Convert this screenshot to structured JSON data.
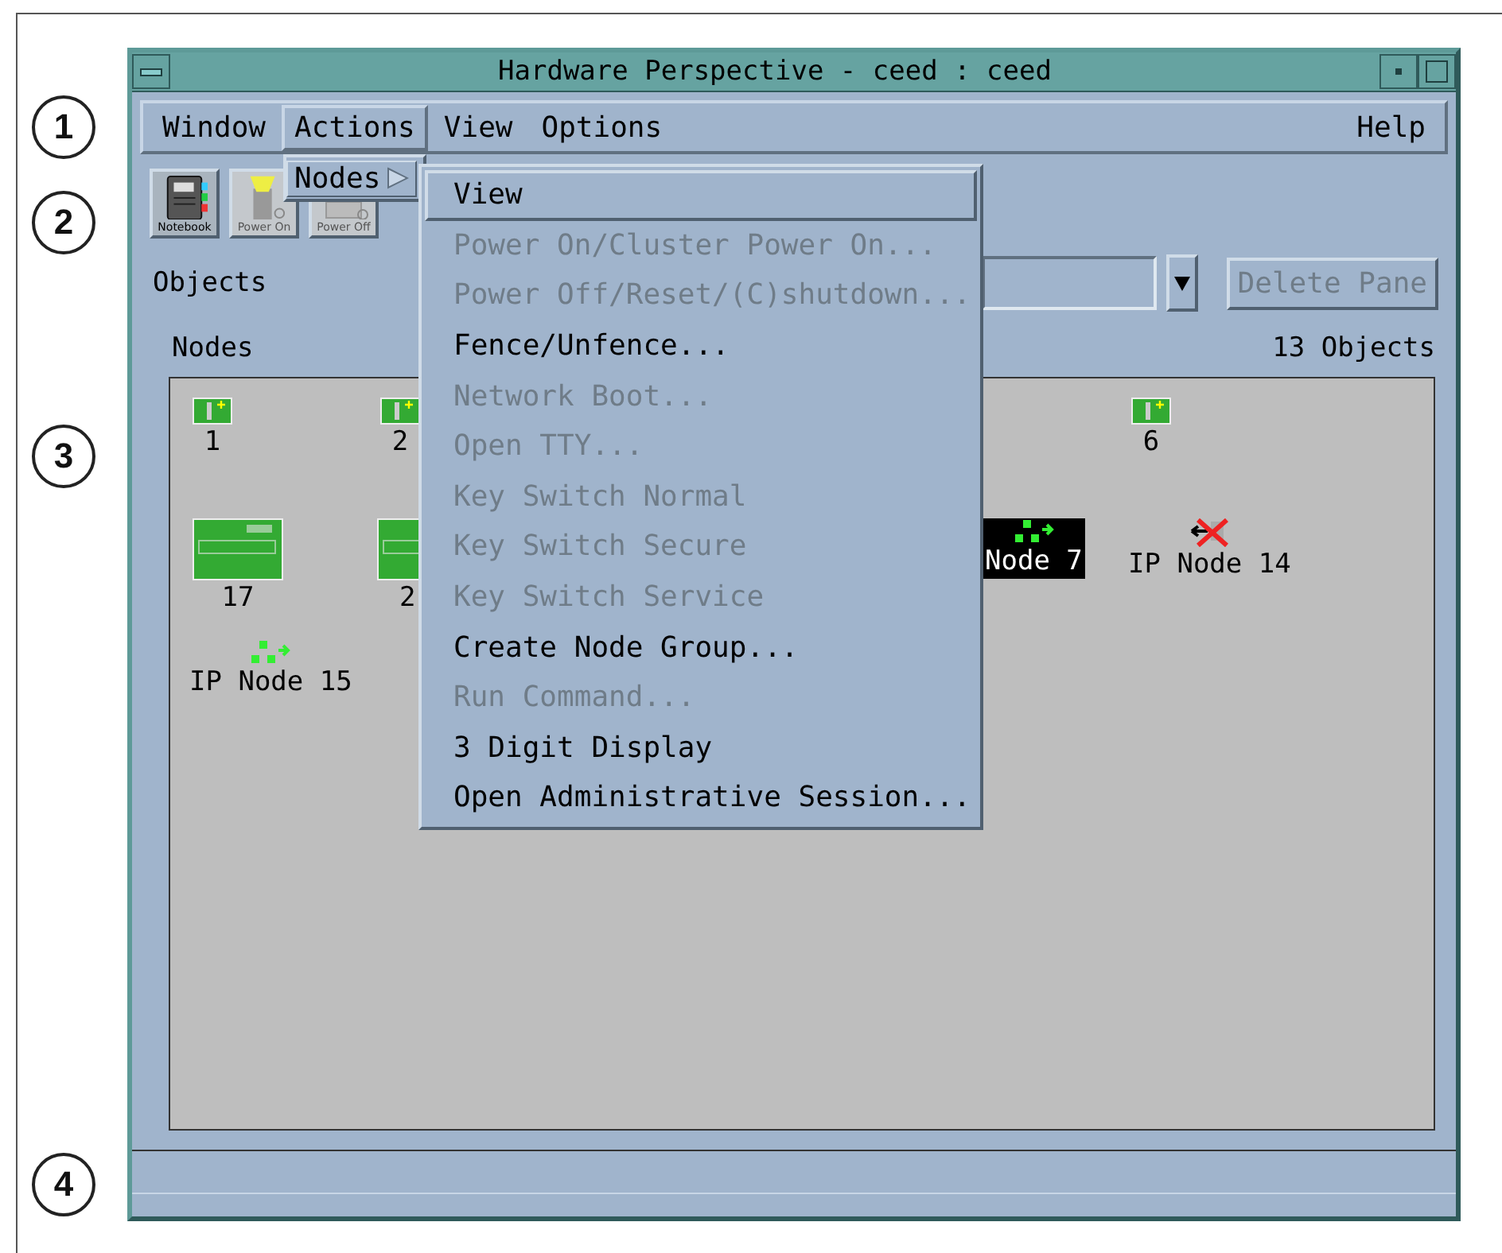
{
  "callouts": [
    "1",
    "2",
    "3",
    "4"
  ],
  "window": {
    "title": "Hardware Perspective - ceed : ceed"
  },
  "menubar": [
    {
      "label": "Window",
      "selected": false
    },
    {
      "label": "Actions",
      "selected": true
    },
    {
      "label": "View",
      "selected": false
    },
    {
      "label": "Options",
      "selected": false
    },
    {
      "label": "Help",
      "selected": false
    }
  ],
  "toolbar": [
    {
      "label": "Notebook",
      "kind": "notebook",
      "disabled": false
    },
    {
      "label": "Power On",
      "kind": "power-on",
      "disabled": true
    },
    {
      "label": "Power Off",
      "kind": "power-off",
      "disabled": true
    }
  ],
  "objects": {
    "label": "Objects",
    "delete_button": {
      "label": "Delete Pane",
      "disabled": true
    }
  },
  "pane": {
    "title": "Nodes",
    "count": "13 Objects",
    "items": [
      {
        "label": "1",
        "kind": "node",
        "selected": false
      },
      {
        "label": "2",
        "kind": "node",
        "selected": false
      },
      {
        "label": "6",
        "kind": "node",
        "selected": false
      },
      {
        "label": "17",
        "kind": "rack",
        "selected": false
      },
      {
        "label": "2",
        "kind": "rack",
        "selected": false
      },
      {
        "label": "Node 7",
        "kind": "ip",
        "selected": true
      },
      {
        "label": "IP Node 14",
        "kind": "ip-down",
        "selected": false
      },
      {
        "label": "IP Node 15",
        "kind": "ip",
        "selected": false
      }
    ]
  },
  "actions_menu": [
    {
      "label": "Nodes",
      "selected": true
    }
  ],
  "submenu": [
    {
      "label": "View",
      "disabled": false,
      "selected": true
    },
    {
      "label": "Power On/Cluster Power On...",
      "disabled": true,
      "selected": false
    },
    {
      "label": "Power Off/Reset/(C)shutdown...",
      "disabled": true,
      "selected": false
    },
    {
      "label": "Fence/Unfence...",
      "disabled": false,
      "selected": false
    },
    {
      "label": "Network Boot...",
      "disabled": true,
      "selected": false
    },
    {
      "label": "Open TTY...",
      "disabled": true,
      "selected": false
    },
    {
      "label": "Key Switch Normal",
      "disabled": true,
      "selected": false
    },
    {
      "label": "Key Switch Secure",
      "disabled": true,
      "selected": false
    },
    {
      "label": "Key Switch Service",
      "disabled": true,
      "selected": false
    },
    {
      "label": "Create Node Group...",
      "disabled": false,
      "selected": false
    },
    {
      "label": "Run Command...",
      "disabled": true,
      "selected": false
    },
    {
      "label": "3 Digit Display",
      "disabled": false,
      "selected": false
    },
    {
      "label": "Open Administrative Session...",
      "disabled": false,
      "selected": false
    }
  ]
}
